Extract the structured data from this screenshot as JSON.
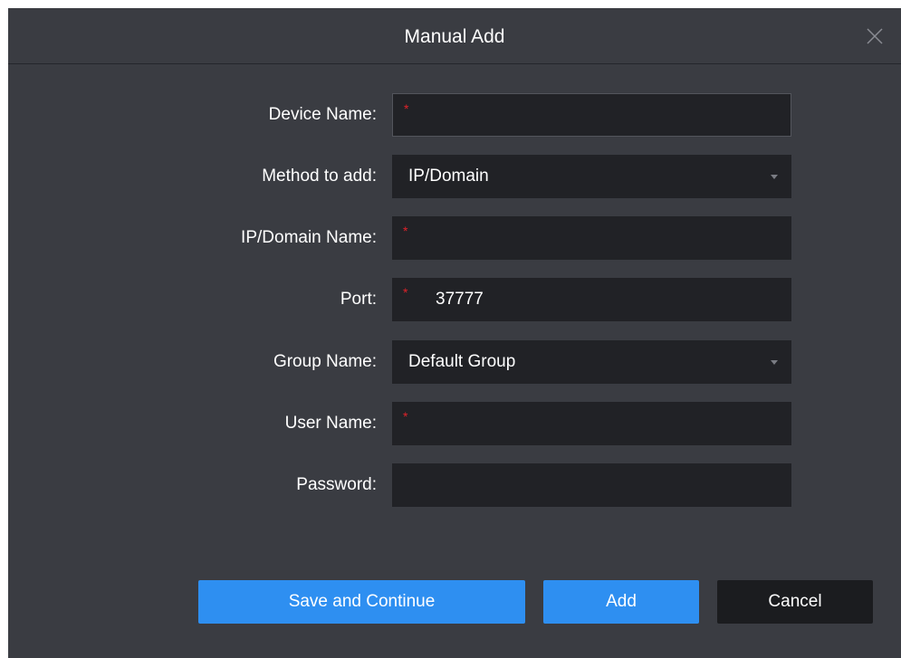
{
  "dialog": {
    "title": "Manual Add"
  },
  "form": {
    "device_name": {
      "label": "Device Name:",
      "value": "",
      "required": "*"
    },
    "method_to_add": {
      "label": "Method to add:",
      "value": "IP/Domain"
    },
    "ip_domain_name": {
      "label": "IP/Domain Name:",
      "value": "",
      "required": "*"
    },
    "port": {
      "label": "Port:",
      "value": "37777",
      "required": "*"
    },
    "group_name": {
      "label": "Group Name:",
      "value": "Default Group"
    },
    "user_name": {
      "label": "User Name:",
      "value": "",
      "required": "*"
    },
    "password": {
      "label": "Password:",
      "value": ""
    }
  },
  "buttons": {
    "save_and_continue": "Save and Continue",
    "add": "Add",
    "cancel": "Cancel"
  },
  "colors": {
    "dialog_background": "#3a3c42",
    "input_background": "#212226",
    "required_marker": "#e0222a",
    "primary_button": "#2e8ff1",
    "secondary_button": "#1b1c1f",
    "text": "#ffffff"
  },
  "icons": {
    "close": "close-icon",
    "dropdown": "chevron-down-icon"
  }
}
